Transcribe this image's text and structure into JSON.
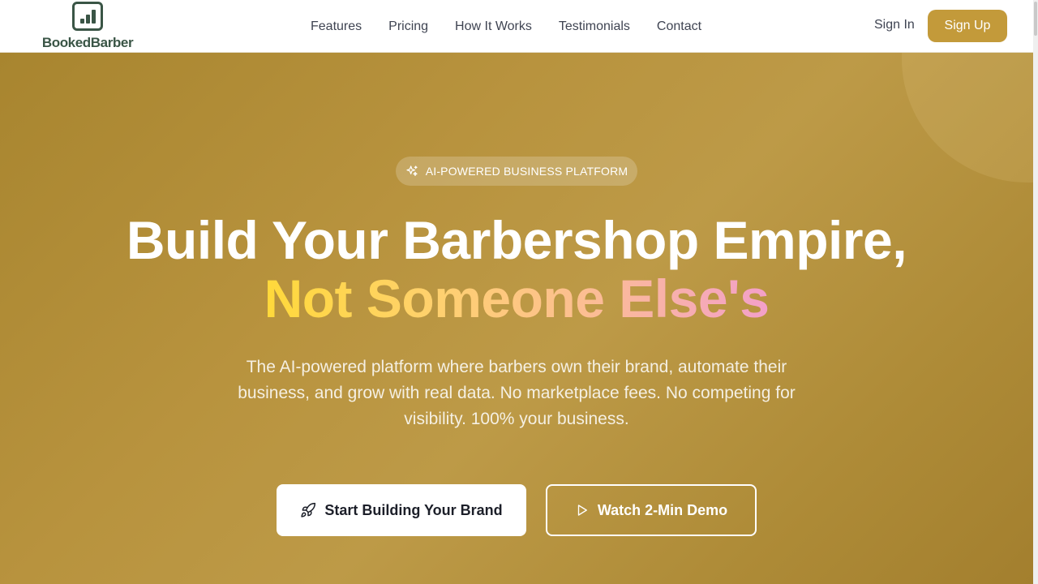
{
  "brand": {
    "name": "BookedBarber",
    "logo_icon": "bar-chart-icon",
    "primary_color": "#3a5546",
    "accent_color": "#c39a3a"
  },
  "nav": {
    "items": [
      {
        "label": "Features"
      },
      {
        "label": "Pricing"
      },
      {
        "label": "How It Works"
      },
      {
        "label": "Testimonials"
      },
      {
        "label": "Contact"
      }
    ]
  },
  "auth": {
    "sign_in_label": "Sign In",
    "sign_up_label": "Sign Up"
  },
  "hero": {
    "badge_icon": "sparkles-icon",
    "badge_text": "AI-POWERED BUSINESS PLATFORM",
    "headline_line1": "Build Your Barbershop Empire,",
    "headline_line2": "Not Someone Else's",
    "subtext": "The AI-powered platform where barbers own their brand, automate their business, and grow with real data. No marketplace fees. No competing for visibility. 100% your business.",
    "primary_cta": {
      "label": "Start Building Your Brand",
      "icon": "rocket-icon"
    },
    "secondary_cta": {
      "label": "Watch 2-Min Demo",
      "icon": "play-icon"
    },
    "background_color": "#b8933e"
  }
}
